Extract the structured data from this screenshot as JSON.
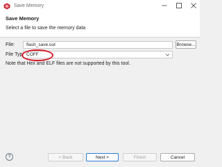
{
  "window": {
    "title": "Save Memory",
    "icons": {
      "app": "app-logo-icon",
      "minimize": "minimize-icon",
      "maximize": "maximize-icon",
      "close": "close-icon"
    }
  },
  "header": {
    "title": "Save Memory",
    "description": "Select a file to save the memory data"
  },
  "form": {
    "file_label": "File:",
    "file_value": "flash_save.out",
    "browse_label": "Browse...",
    "file_type_label": "File Type:",
    "file_type_value": "COFF",
    "note": "Note that Hex and ELF files are not supported by this tool."
  },
  "annotation": {
    "color": "#d7192b"
  },
  "footer": {
    "help_symbol": "?",
    "back_label": "< Back",
    "next_label": "Next >",
    "finish_label": "Finish",
    "cancel_label": "Cancel"
  },
  "colors": {
    "accent": "#2f7bd2"
  }
}
